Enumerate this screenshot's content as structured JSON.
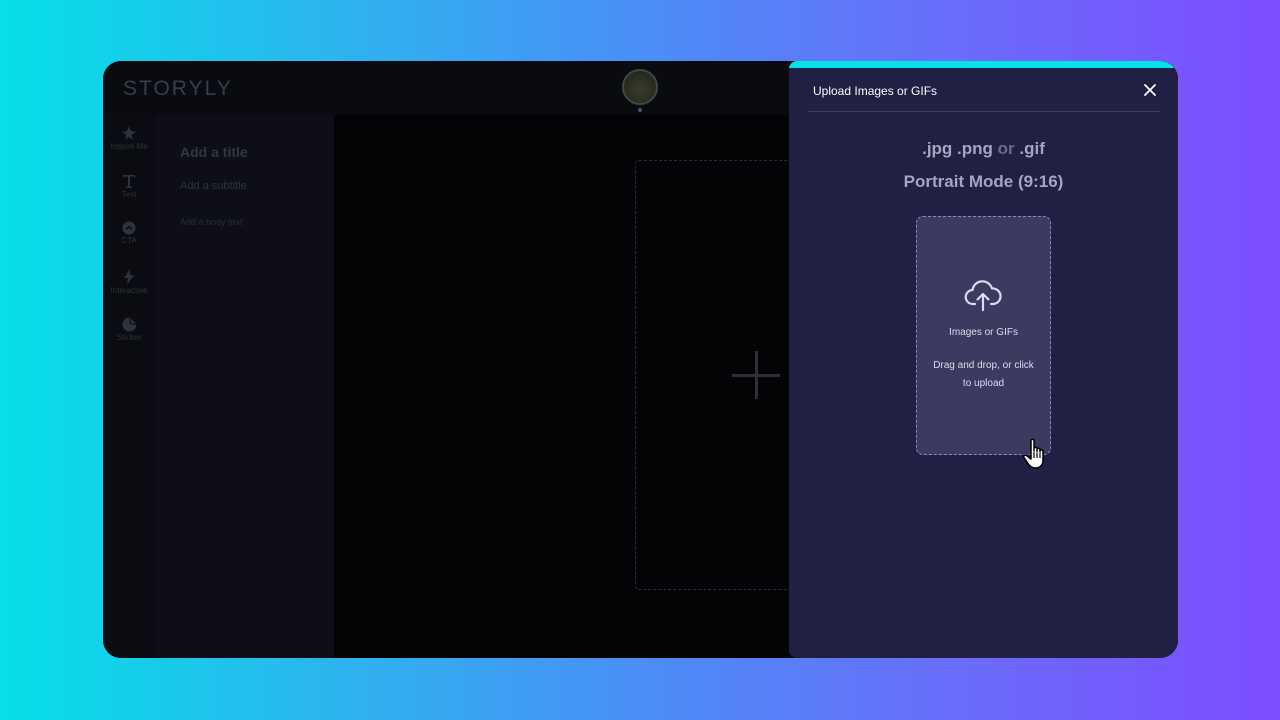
{
  "app": {
    "logo": "STORYLY"
  },
  "toolbar": {
    "items": [
      {
        "label": "Inspire Me",
        "icon": "sparkle-icon"
      },
      {
        "label": "Text",
        "icon": "text-icon"
      },
      {
        "label": "CTA",
        "icon": "cta-icon"
      },
      {
        "label": "Interactive",
        "icon": "bolt-icon"
      },
      {
        "label": "Sticker",
        "icon": "sticker-icon"
      }
    ]
  },
  "text_panel": {
    "title": "Add a title",
    "subtitle": "Add a subtitle",
    "body": "Add a body text"
  },
  "upload_panel": {
    "title": "Upload Images or GIFs",
    "formats_part1": ".jpg .png",
    "formats_or": "or",
    "formats_part2": ".gif",
    "mode": "Portrait Mode (9:16)",
    "dropzone_title": "Images or GIFs",
    "dropzone_hint": "Drag and drop, or click to upload"
  },
  "colors": {
    "accent": "#06e2e8",
    "panel_bg": "#201f44",
    "dropzone_bg": "#3b3a61"
  }
}
